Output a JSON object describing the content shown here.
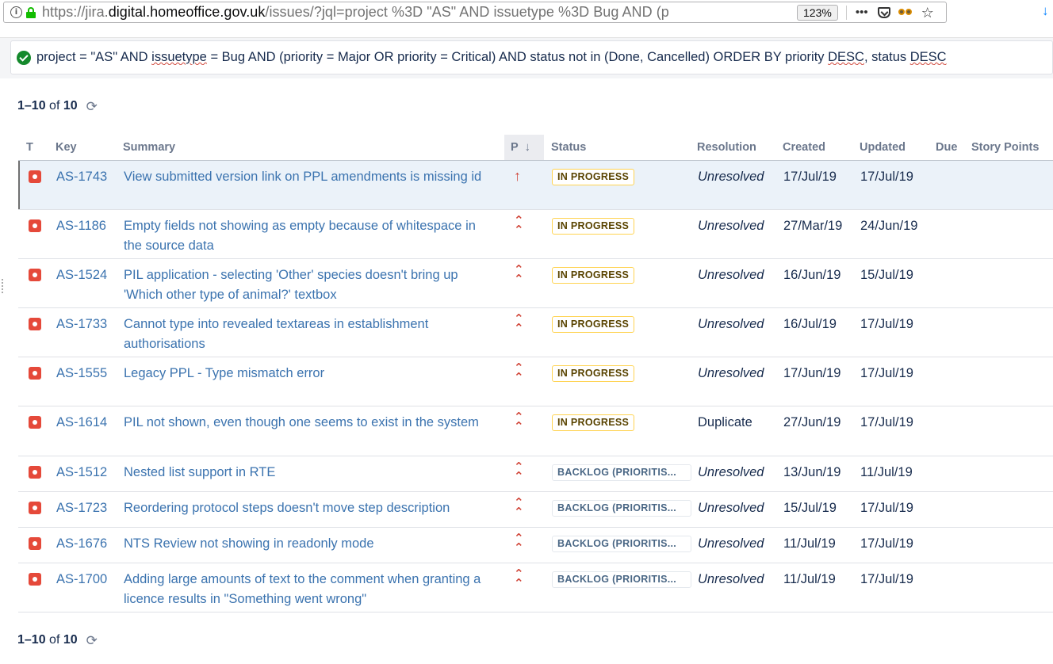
{
  "browser": {
    "url_scheme": "https://jira.",
    "url_host": "digital.homeoffice.gov.uk",
    "url_path": "/issues/?jql=project %3D \"AS\" AND issuetype %3D Bug AND (p",
    "zoom": "123%",
    "page_actions_icon": "ellipsis-icon",
    "pocket_icon": "pocket-icon",
    "bookmark_icon": "star-icon"
  },
  "search": {
    "jql_parts": [
      "project = \"AS\" AND ",
      "issuetype",
      " = Bug AND (priority = Major OR priority = Critical) AND status not in (Done, Cancelled) ORDER BY priority ",
      "DESC",
      ", status ",
      "DESC"
    ]
  },
  "pager_top": {
    "range": "1–10",
    "of": "of",
    "total": "10"
  },
  "pager_bottom": {
    "range": "1–10",
    "of": "of",
    "total": "10"
  },
  "columns": {
    "type": "T",
    "key": "Key",
    "summary": "Summary",
    "priority": "P",
    "status": "Status",
    "resolution": "Resolution",
    "created": "Created",
    "updated": "Updated",
    "due": "Due",
    "story_points": "Story Points"
  },
  "issues": [
    {
      "key": "AS-1743",
      "summary": "View submitted version link on PPL amendments is missing id",
      "priority": "critical",
      "status": "IN PROGRESS",
      "status_type": "inprogress",
      "resolution": "Unresolved",
      "created": "17/Jul/19",
      "updated": "17/Jul/19",
      "due": "",
      "story_points": ""
    },
    {
      "key": "AS-1186",
      "summary": "Empty fields not showing as empty because of whitespace in the source data",
      "priority": "major",
      "status": "IN PROGRESS",
      "status_type": "inprogress",
      "resolution": "Unresolved",
      "created": "27/Mar/19",
      "updated": "24/Jun/19",
      "due": "",
      "story_points": ""
    },
    {
      "key": "AS-1524",
      "summary": "PIL application - selecting 'Other' species doesn't bring up 'Which other type of animal?' textbox",
      "priority": "major",
      "status": "IN PROGRESS",
      "status_type": "inprogress",
      "resolution": "Unresolved",
      "created": "16/Jun/19",
      "updated": "15/Jul/19",
      "due": "",
      "story_points": ""
    },
    {
      "key": "AS-1733",
      "summary": "Cannot type into revealed textareas in establishment authorisations",
      "priority": "major",
      "status": "IN PROGRESS",
      "status_type": "inprogress",
      "resolution": "Unresolved",
      "created": "16/Jul/19",
      "updated": "17/Jul/19",
      "due": "",
      "story_points": ""
    },
    {
      "key": "AS-1555",
      "summary": "Legacy PPL - Type mismatch error",
      "priority": "major",
      "status": "IN PROGRESS",
      "status_type": "inprogress",
      "resolution": "Unresolved",
      "created": "17/Jun/19",
      "updated": "17/Jul/19",
      "due": "",
      "story_points": ""
    },
    {
      "key": "AS-1614",
      "summary": "PIL not shown, even though one seems to exist in the system",
      "priority": "major",
      "status": "IN PROGRESS",
      "status_type": "inprogress",
      "resolution": "Duplicate",
      "created": "27/Jun/19",
      "updated": "17/Jul/19",
      "due": "",
      "story_points": ""
    },
    {
      "key": "AS-1512",
      "summary": "Nested list support in RTE",
      "priority": "major",
      "status": "BACKLOG (PRIORITIS...",
      "status_type": "backlog",
      "resolution": "Unresolved",
      "created": "13/Jun/19",
      "updated": "11/Jul/19",
      "due": "",
      "story_points": ""
    },
    {
      "key": "AS-1723",
      "summary": "Reordering protocol steps doesn't move step description",
      "priority": "major",
      "status": "BACKLOG (PRIORITIS...",
      "status_type": "backlog",
      "resolution": "Unresolved",
      "created": "15/Jul/19",
      "updated": "17/Jul/19",
      "due": "",
      "story_points": ""
    },
    {
      "key": "AS-1676",
      "summary": "NTS Review not showing in readonly mode",
      "priority": "major",
      "status": "BACKLOG (PRIORITIS...",
      "status_type": "backlog",
      "resolution": "Unresolved",
      "created": "11/Jul/19",
      "updated": "17/Jul/19",
      "due": "",
      "story_points": ""
    },
    {
      "key": "AS-1700",
      "summary": "Adding large amounts of text to the comment when granting a licence results in \"Something went wrong\"",
      "priority": "major",
      "status": "BACKLOG (PRIORITIS...",
      "status_type": "backlog",
      "resolution": "Unresolved",
      "created": "11/Jul/19",
      "updated": "17/Jul/19",
      "due": "",
      "story_points": ""
    }
  ],
  "colors": {
    "link": "#3b73af",
    "bug": "#e5493a",
    "priority": "#d04437",
    "inprogress_text": "#594300",
    "inprogress_border": "#ffd351",
    "backlog_text": "#4a6785",
    "selected_row": "#ebf2f9"
  }
}
